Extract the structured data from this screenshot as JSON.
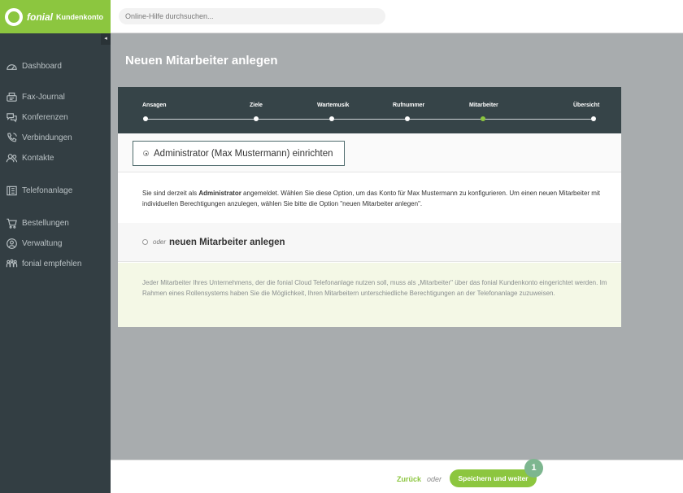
{
  "header": {
    "brand": "fonial",
    "product": "Kundenkonto",
    "search_placeholder": "Online-Hilfe durchsuchen..."
  },
  "sidebar": {
    "collapse_glyph": "◂",
    "items": [
      {
        "label": "Dashboard",
        "icon": "gauge-icon"
      },
      {
        "label": "Fax-Journal",
        "icon": "fax-icon"
      },
      {
        "label": "Konferenzen",
        "icon": "chat-bubbles-icon"
      },
      {
        "label": "Verbindungen",
        "icon": "phone-icon"
      },
      {
        "label": "Kontakte",
        "icon": "contacts-icon"
      },
      {
        "label": "Telefonanlage",
        "icon": "pbx-icon"
      },
      {
        "label": "Bestellungen",
        "icon": "cart-icon"
      },
      {
        "label": "Verwaltung",
        "icon": "user-circle-icon"
      },
      {
        "label": "fonial empfehlen",
        "icon": "recommend-icon"
      }
    ]
  },
  "main": {
    "title": "Neuen Mitarbeiter anlegen",
    "steps": [
      {
        "label": "Ansagen",
        "active": false
      },
      {
        "label": "Ziele",
        "active": false
      },
      {
        "label": "Wartemusik",
        "active": false
      },
      {
        "label": "Rufnummer",
        "active": false
      },
      {
        "label": "Mitarbeiter",
        "active": true
      },
      {
        "label": "Übersicht",
        "active": false
      }
    ],
    "option_admin": {
      "label": "Administrator (Max Mustermann) einrichten",
      "selected": true
    },
    "description": {
      "part1": "Sie sind derzeit als ",
      "bold": "Administrator",
      "part2": " angemeldet. Wählen Sie diese Option, um das Konto für Max Mustermann zu konfigurieren. Um einen neuen Mitarbeiter mit individuellen Berechtigungen anzulegen, wählen Sie bitte die Option \"neuen Mitarbeiter anlegen\"."
    },
    "option_new": {
      "prefix": "oder",
      "label": "neuen Mitarbeiter anlegen",
      "selected": false
    },
    "info_text": "Jeder Mitarbeiter Ihres Unternehmens, der die fonial Cloud Telefonanlage nutzen soll, muss als „Mitarbeiter\" über das fonial Kundenkonto eingerichtet werden. Im Rahmen eines Rollensystems haben Sie die Möglichkeit, Ihren Mitarbeitern unterschiedliche Berechtigungen an der Telefonanlage zuzuweisen."
  },
  "footer": {
    "back_label": "Zurück",
    "or_label": "oder",
    "save_label": "Speichern und weiter",
    "badge": "1"
  },
  "colors": {
    "brand_green": "#8cc63f",
    "sidebar_bg": "#333e43",
    "stepbar_bg": "#364448",
    "content_bg": "#a8acae"
  }
}
